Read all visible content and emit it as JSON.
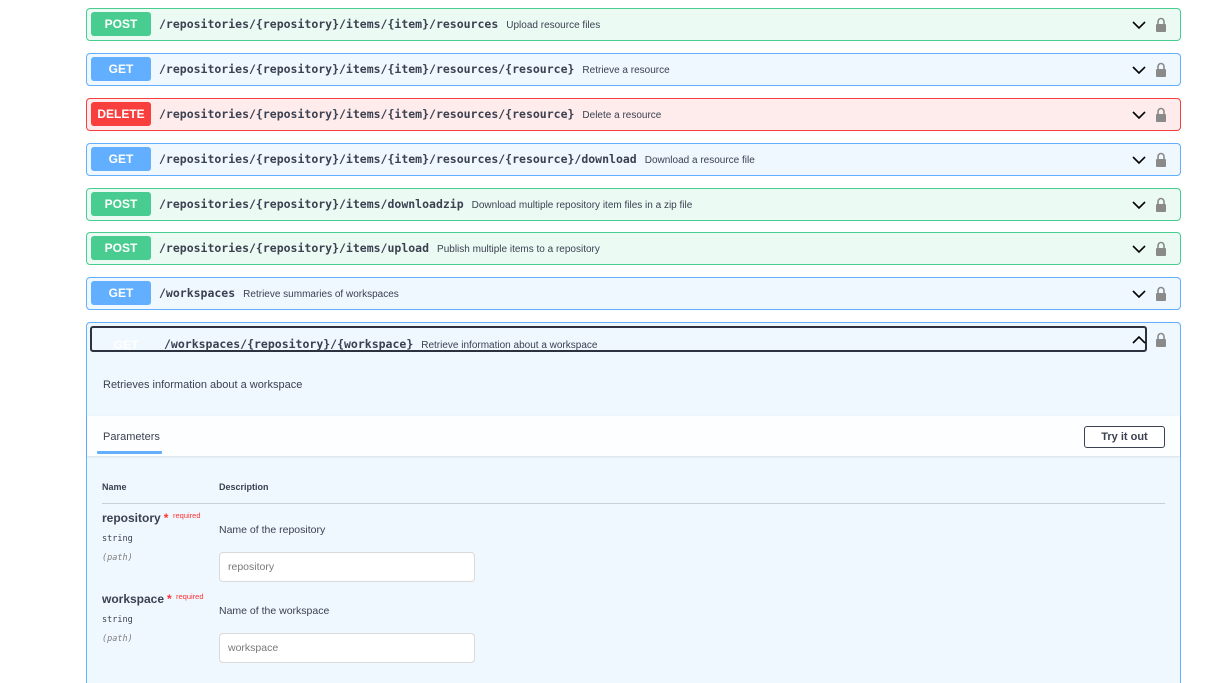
{
  "endpoints": [
    {
      "method": "POST",
      "path": "/repositories/{repository}/items/{item}/resources",
      "summary": "Upload resource files"
    },
    {
      "method": "GET",
      "path": "/repositories/{repository}/items/{item}/resources/{resource}",
      "summary": "Retrieve a resource"
    },
    {
      "method": "DELETE",
      "path": "/repositories/{repository}/items/{item}/resources/{resource}",
      "summary": "Delete a resource"
    },
    {
      "method": "GET",
      "path": "/repositories/{repository}/items/{item}/resources/{resource}/download",
      "summary": "Download a resource file"
    },
    {
      "method": "POST",
      "path": "/repositories/{repository}/items/downloadzip",
      "summary": "Download multiple repository item files in a zip file"
    },
    {
      "method": "POST",
      "path": "/repositories/{repository}/items/upload",
      "summary": "Publish multiple items to a repository"
    },
    {
      "method": "GET",
      "path": "/workspaces",
      "summary": "Retrieve summaries of workspaces"
    }
  ],
  "expanded": {
    "method": "GET",
    "path": "/workspaces/{repository}/{workspace}",
    "summary": "Retrieve information about a workspace",
    "description": "Retrieves information about a workspace",
    "parameters_tab": "Parameters",
    "try_it_out": "Try it out",
    "columns": {
      "name": "Name",
      "description": "Description"
    },
    "parameters": [
      {
        "name": "repository",
        "required_mark": "*",
        "required_label": "required",
        "type": "string",
        "in": "(path)",
        "description": "Name of the repository",
        "placeholder": "repository"
      },
      {
        "name": "workspace",
        "required_mark": "*",
        "required_label": "required",
        "type": "string",
        "in": "(path)",
        "description": "Name of the workspace",
        "placeholder": "workspace"
      }
    ]
  },
  "colors": {
    "post": "#49cc90",
    "get": "#61affe",
    "delete": "#f93e3e"
  },
  "icons": {
    "expand": "chevron-down-icon",
    "collapse": "chevron-up-icon",
    "auth": "lock-icon"
  }
}
